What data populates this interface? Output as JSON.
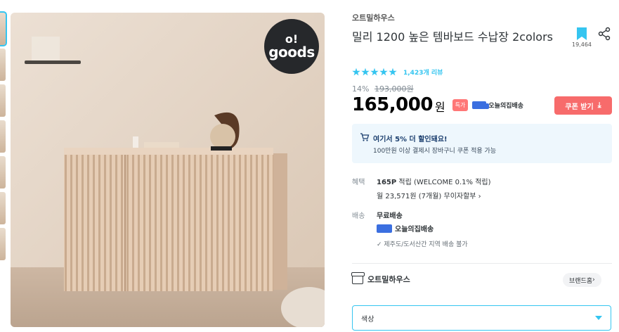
{
  "brand_badge": {
    "line1": "o!",
    "line2": "goods"
  },
  "product": {
    "brand": "오트밀하우스",
    "title": "밀리 1200 높은 템바보드 수납장 2colors",
    "bookmark_count": "19,464",
    "rating": 5,
    "review_count": "1,423개 리뷰",
    "discount_rate": "14%",
    "original_price": "193,000원",
    "price": "165,000",
    "currency": "원",
    "special_badge": "특가",
    "delivery_badge": "오늘의집배송",
    "coupon_button": "쿠폰 받기"
  },
  "promo": {
    "title": "여기서 5% 더 할인돼요!",
    "subtitle": "100만원 이상 결제시 장바구니 쿠폰 적용 가능"
  },
  "benefit": {
    "label": "혜택",
    "points": "165P",
    "points_rest": "적립 (WELCOME 0.1% 적립)",
    "installment": "월 23,571원 (7개월) 무이자할부"
  },
  "shipping": {
    "label": "배송",
    "free": "무료배송",
    "service": "오늘의집배송",
    "note": "제주도/도서산간 지역 배송 불가"
  },
  "store": {
    "name": "오트밀하우스",
    "home_button": "브랜드홈"
  },
  "option_select": {
    "value": "색상"
  },
  "colors": {
    "accent": "#35c5f0",
    "coupon": "#f76b6b",
    "special": "#ff7777",
    "promo_bg": "#eef7fd"
  }
}
